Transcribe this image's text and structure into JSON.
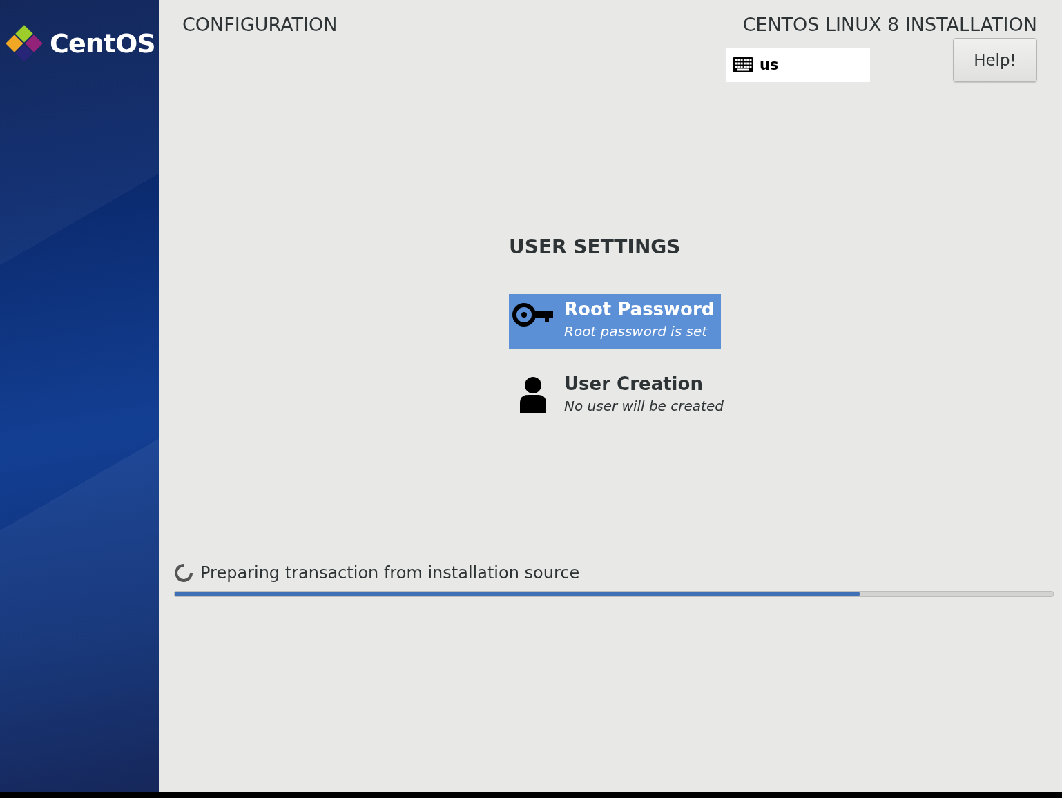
{
  "sidebar": {
    "logo_text": "CentOS"
  },
  "header": {
    "section_title": "CONFIGURATION",
    "product_title": "CENTOS LINUX 8 INSTALLATION",
    "keyboard_layout": "us",
    "help_button": "Help!"
  },
  "user_settings": {
    "title": "USER SETTINGS",
    "spokes": [
      {
        "kind": "key",
        "title": "Root Password",
        "status": "Root password is set",
        "selected": true
      },
      {
        "kind": "user",
        "title": "User Creation",
        "status": "No user will be created",
        "selected": false
      }
    ]
  },
  "progress": {
    "message": "Preparing transaction from installation source",
    "level": 0.78
  }
}
